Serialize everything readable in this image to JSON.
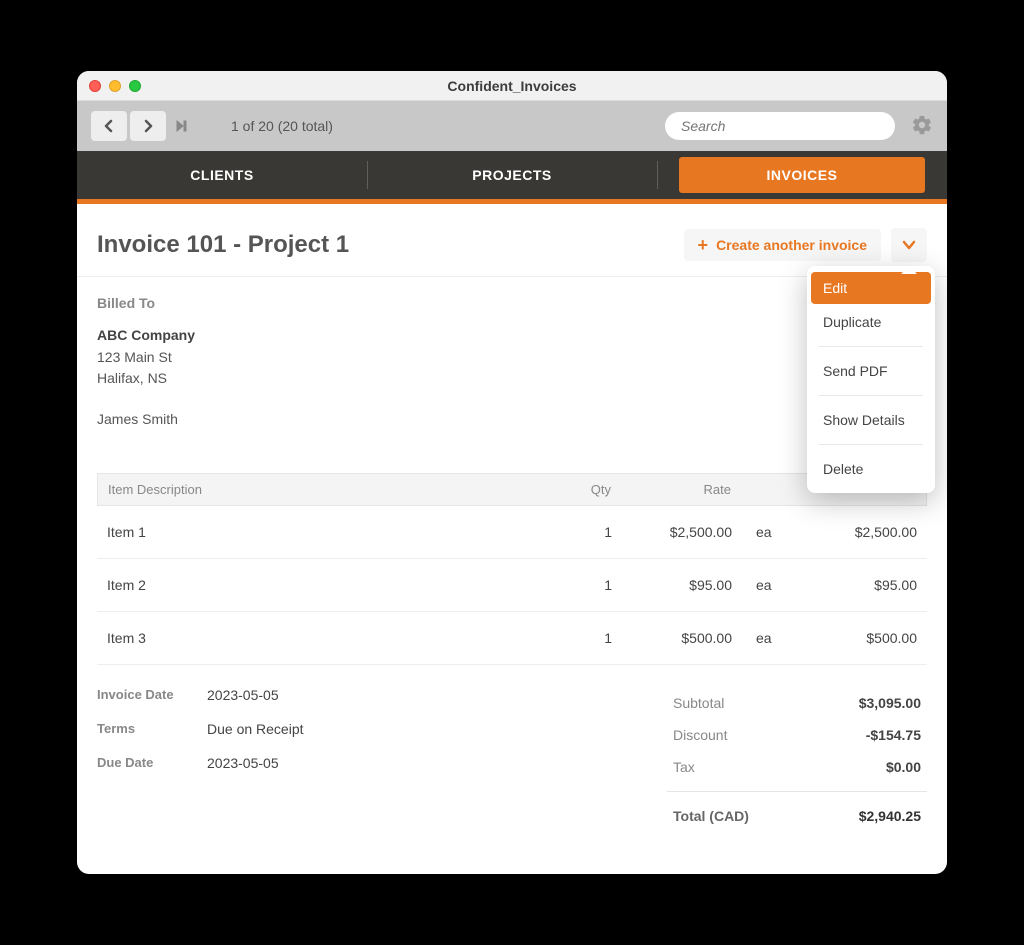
{
  "window": {
    "title": "Confident_Invoices"
  },
  "toolbar": {
    "counter": "1 of 20  (20 total)",
    "search_placeholder": "Search"
  },
  "tabs": {
    "clients": "CLIENTS",
    "projects": "PROJECTS",
    "invoices": "INVOICES"
  },
  "header": {
    "title": "Invoice 101 - Project 1",
    "create_label": "Create another invoice"
  },
  "dropdown": {
    "edit": "Edit",
    "duplicate": "Duplicate",
    "send_pdf": "Send PDF",
    "show_details": "Show Details",
    "delete": "Delete"
  },
  "billed": {
    "label": "Billed To",
    "company": "ABC Company",
    "street": "123 Main St",
    "city": "Halifax, NS",
    "contact": "James Smith"
  },
  "table": {
    "hdr_desc": "Item Description",
    "hdr_qty": "Qty",
    "hdr_rate": "Rate",
    "rows": [
      {
        "desc": "Item 1",
        "qty": "1",
        "rate": "$2,500.00",
        "unit": "ea",
        "total": "$2,500.00"
      },
      {
        "desc": "Item 2",
        "qty": "1",
        "rate": "$95.00",
        "unit": "ea",
        "total": "$95.00"
      },
      {
        "desc": "Item 3",
        "qty": "1",
        "rate": "$500.00",
        "unit": "ea",
        "total": "$500.00"
      }
    ]
  },
  "meta": {
    "invoice_date_label": "Invoice Date",
    "invoice_date": "2023-05-05",
    "terms_label": "Terms",
    "terms": "Due on Receipt",
    "due_date_label": "Due Date",
    "due_date": "2023-05-05"
  },
  "totals": {
    "subtotal_label": "Subtotal",
    "subtotal": "$3,095.00",
    "discount_label": "Discount",
    "discount": "-$154.75",
    "tax_label": "Tax",
    "tax": "$0.00",
    "total_label": "Total (CAD)",
    "total": "$2,940.25"
  }
}
